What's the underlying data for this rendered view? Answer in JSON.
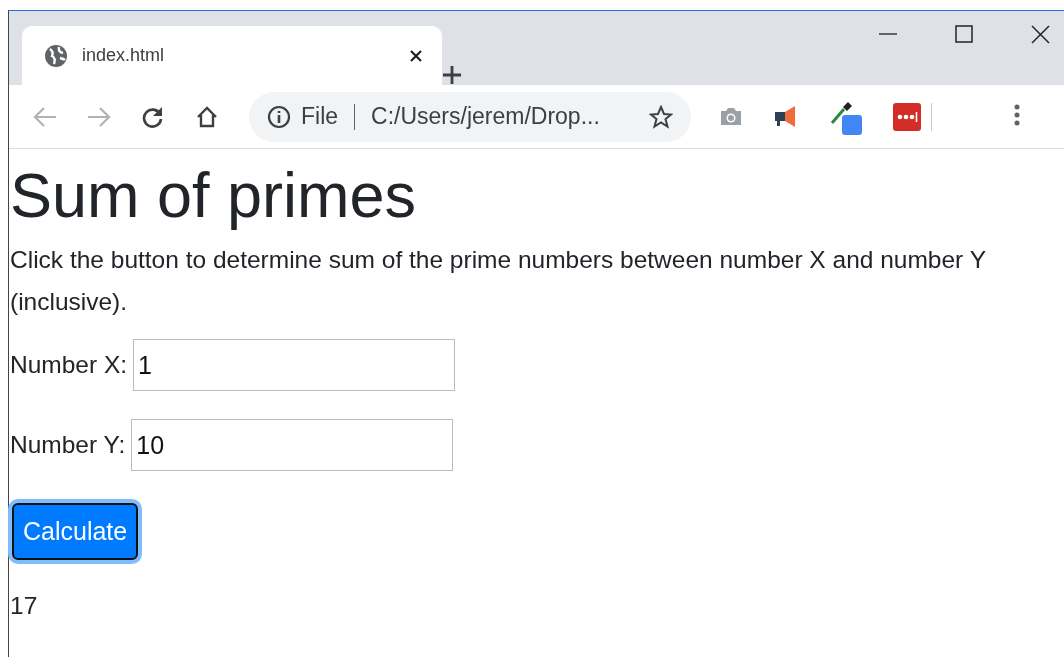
{
  "browser": {
    "tab": {
      "title": "index.html"
    },
    "address": {
      "scheme": "File",
      "url": "C:/Users/jerem/Drop..."
    }
  },
  "page": {
    "heading": "Sum of primes",
    "description": "Click the button to determine sum of the prime numbers between number X and number Y (inclusive).",
    "fields": [
      {
        "label": "Number X:",
        "value": "1"
      },
      {
        "label": "Number Y:",
        "value": "10"
      }
    ],
    "button": {
      "label": "Calculate",
      "focused": true
    },
    "result": "17"
  }
}
